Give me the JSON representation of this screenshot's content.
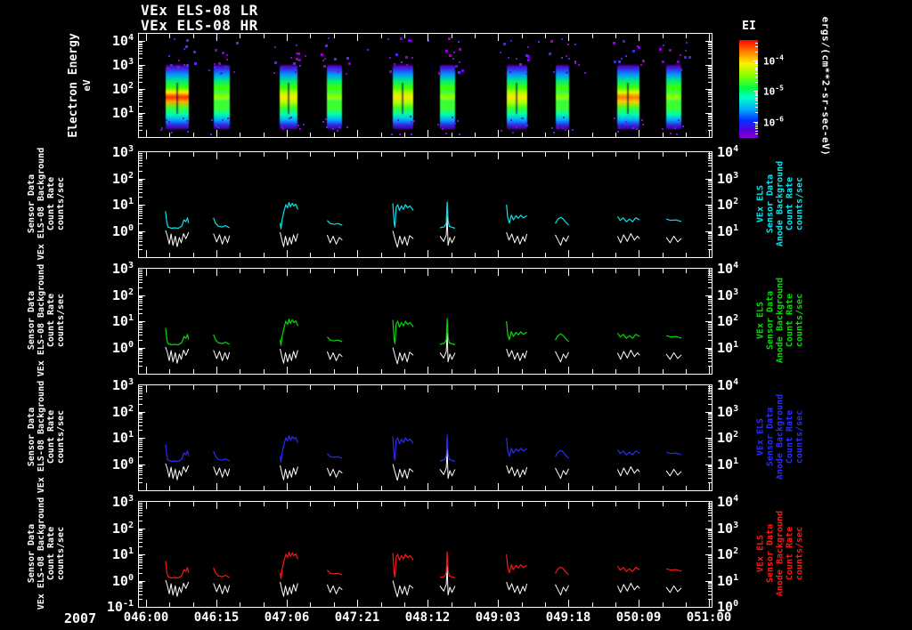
{
  "titles": {
    "line1": "VEx ELS-08 LR",
    "line2": "VEx ELS-08 HR"
  },
  "x_axis": {
    "year": "2007",
    "ticks": [
      {
        "label": "046:00",
        "fx": 0.0124
      },
      {
        "label": "046:15",
        "fx": 0.1354
      },
      {
        "label": "047:06",
        "fx": 0.2583
      },
      {
        "label": "047:21",
        "fx": 0.3813
      },
      {
        "label": "048:12",
        "fx": 0.5042
      },
      {
        "label": "049:03",
        "fx": 0.6272
      },
      {
        "label": "049:18",
        "fx": 0.7501
      },
      {
        "label": "050:09",
        "fx": 0.8731
      },
      {
        "label": "051:00",
        "fx": 0.996
      }
    ]
  },
  "chart_data": [
    {
      "type": "heatmap",
      "name": "electron-energy-spectrogram",
      "ylabel": "Electron Energy",
      "ylabel_units": "eV",
      "yscale": "log",
      "yrange": [
        1,
        20000
      ],
      "ytick_exps": [
        "4",
        "3",
        "2",
        "1"
      ],
      "colorbar": {
        "title": "EI",
        "units": "ergs/(cm**2-sr-sec-eV)",
        "tick_exps": [
          "-4",
          "-5",
          "-6"
        ],
        "tick_fys": [
          0.21,
          0.52,
          0.84
        ]
      },
      "energy_extent_exp": [
        0.55,
        2.95
      ],
      "bursts": [
        {
          "t0": "046:04",
          "t1": "046:09",
          "fx0": 0.0465,
          "fx1": 0.0868,
          "core": "red",
          "streak": true
        },
        {
          "t0": "046:14",
          "t1": "046:18",
          "fx0": 0.1302,
          "fx1": 0.1581,
          "core": "green",
          "streak": false
        },
        {
          "t0": "047:05",
          "t1": "047:08",
          "fx0": 0.2465,
          "fx1": 0.2775,
          "core": "yellow",
          "streak": true
        },
        {
          "t0": "047:15",
          "t1": "047:18",
          "fx0": 0.3287,
          "fx1": 0.355,
          "core": "green",
          "streak": false
        },
        {
          "t0": "048:05",
          "t1": "048:09",
          "fx0": 0.4434,
          "fx1": 0.4791,
          "core": "yellow",
          "streak": true
        },
        {
          "t0": "048:15",
          "t1": "048:18",
          "fx0": 0.5256,
          "fx1": 0.5519,
          "core": "green",
          "streak": false
        },
        {
          "t0": "049:05",
          "t1": "049:09",
          "fx0": 0.6419,
          "fx1": 0.6775,
          "core": "yellow",
          "streak": true
        },
        {
          "t0": "049:15",
          "t1": "049:18",
          "fx0": 0.7271,
          "fx1": 0.7504,
          "core": "green",
          "streak": false
        },
        {
          "t0": "050:04",
          "t1": "050:09",
          "fx0": 0.8357,
          "fx1": 0.8744,
          "core": "orange",
          "streak": true
        },
        {
          "t0": "050:15",
          "t1": "050:18",
          "fx0": 0.9209,
          "fx1": 0.9473,
          "core": "green",
          "streak": false
        }
      ]
    },
    {
      "type": "line",
      "name": "anode-background-count-rate-panels",
      "yscale": "log",
      "yrange": [
        0.1,
        1000
      ],
      "right_yrange": [
        1,
        10000
      ],
      "left_tick_exps": [
        "3",
        "2",
        "1",
        "0"
      ],
      "right_tick_exps": [
        "4",
        "3",
        "2",
        "1"
      ],
      "last_panel_bottom_left_exp": "-1",
      "last_panel_bottom_right_exp": "0",
      "left_label_lines": [
        "Sensor Data",
        "VEx ELS-08 Background",
        "Count Rate",
        "counts/sec"
      ],
      "right_label_lines": [
        "VEx ELS",
        "Sensor Data",
        "Anode Background",
        "Count Rate",
        "counts/sec"
      ],
      "panels": [
        {
          "name": "anode-panel-cyan",
          "color": "#00e6ef"
        },
        {
          "name": "anode-panel-green",
          "color": "#00dd00"
        },
        {
          "name": "anode-panel-blue",
          "color": "#2a2aff"
        },
        {
          "name": "anode-panel-red",
          "color": "#ff1515"
        }
      ],
      "bursts": [
        {
          "fx0": 0.0465,
          "fx1": 0.0868,
          "colored": [
            [
              0,
              0.75
            ],
            [
              0.05,
              0.35
            ],
            [
              0.1,
              0.15
            ],
            [
              0.25,
              0.1
            ],
            [
              0.4,
              0.12
            ],
            [
              0.55,
              0.1
            ],
            [
              0.7,
              0.18
            ],
            [
              0.8,
              0.42
            ],
            [
              0.88,
              0.35
            ],
            [
              0.95,
              0.5
            ],
            [
              1,
              0.3
            ]
          ],
          "white": [
            [
              0,
              0.02
            ],
            [
              0.08,
              -0.2
            ],
            [
              0.16,
              -0.5
            ],
            [
              0.24,
              -0.12
            ],
            [
              0.32,
              -0.55
            ],
            [
              0.42,
              -0.2
            ],
            [
              0.5,
              -0.6
            ],
            [
              0.6,
              -0.25
            ],
            [
              0.68,
              -0.45
            ],
            [
              0.78,
              -0.1
            ],
            [
              0.88,
              -0.3
            ],
            [
              1,
              -0.05
            ]
          ]
        },
        {
          "fx0": 0.1302,
          "fx1": 0.1581,
          "colored": [
            [
              0,
              0.5
            ],
            [
              0.12,
              0.3
            ],
            [
              0.3,
              0.18
            ],
            [
              0.55,
              0.15
            ],
            [
              0.75,
              0.2
            ],
            [
              1,
              0.12
            ]
          ],
          "white": [
            [
              0,
              -0.1
            ],
            [
              0.2,
              -0.42
            ],
            [
              0.38,
              -0.15
            ],
            [
              0.55,
              -0.5
            ],
            [
              0.72,
              -0.2
            ],
            [
              0.88,
              -0.45
            ],
            [
              1,
              -0.18
            ]
          ]
        },
        {
          "fx0": 0.2465,
          "fx1": 0.2775,
          "colored": [
            [
              0,
              0.3
            ],
            [
              0.05,
              0.08
            ],
            [
              0.12,
              0.45
            ],
            [
              0.22,
              0.75
            ],
            [
              0.32,
              1.0
            ],
            [
              0.42,
              0.88
            ],
            [
              0.5,
              1.08
            ],
            [
              0.58,
              0.92
            ],
            [
              0.68,
              1.05
            ],
            [
              0.78,
              0.95
            ],
            [
              0.88,
              1.02
            ],
            [
              1,
              0.82
            ]
          ],
          "white": [
            [
              0,
              -0.05
            ],
            [
              0.1,
              -0.35
            ],
            [
              0.2,
              -0.6
            ],
            [
              0.3,
              -0.2
            ],
            [
              0.42,
              -0.55
            ],
            [
              0.54,
              -0.25
            ],
            [
              0.64,
              -0.5
            ],
            [
              0.76,
              -0.15
            ],
            [
              0.88,
              -0.4
            ],
            [
              1,
              -0.1
            ]
          ]
        },
        {
          "fx0": 0.3287,
          "fx1": 0.355,
          "colored": [
            [
              0,
              0.4
            ],
            [
              0.2,
              0.28
            ],
            [
              0.45,
              0.25
            ],
            [
              0.7,
              0.28
            ],
            [
              1,
              0.22
            ]
          ],
          "white": [
            [
              0,
              -0.15
            ],
            [
              0.2,
              -0.45
            ],
            [
              0.4,
              -0.2
            ],
            [
              0.6,
              -0.5
            ],
            [
              0.8,
              -0.25
            ],
            [
              1,
              -0.35
            ]
          ]
        },
        {
          "fx0": 0.4434,
          "fx1": 0.4791,
          "colored": [
            [
              0,
              1.05
            ],
            [
              0.06,
              0.3
            ],
            [
              0.1,
              0.15
            ],
            [
              0.16,
              0.9
            ],
            [
              0.24,
              1.0
            ],
            [
              0.32,
              0.78
            ],
            [
              0.42,
              0.95
            ],
            [
              0.52,
              0.82
            ],
            [
              0.62,
              1.0
            ],
            [
              0.72,
              0.88
            ],
            [
              0.84,
              0.95
            ],
            [
              1,
              0.78
            ]
          ],
          "white": [
            [
              0,
              0.0
            ],
            [
              0.1,
              -0.3
            ],
            [
              0.22,
              -0.62
            ],
            [
              0.34,
              -0.2
            ],
            [
              0.46,
              -0.5
            ],
            [
              0.58,
              -0.22
            ],
            [
              0.7,
              -0.55
            ],
            [
              0.82,
              -0.18
            ],
            [
              1,
              -0.3
            ]
          ]
        },
        {
          "fx0": 0.5256,
          "fx1": 0.5519,
          "colored": [
            [
              0,
              0.12
            ],
            [
              0.3,
              0.16
            ],
            [
              0.42,
              0.3
            ],
            [
              0.48,
              1.1
            ],
            [
              0.54,
              0.4
            ],
            [
              0.62,
              0.18
            ],
            [
              0.8,
              0.14
            ],
            [
              1,
              0.1
            ]
          ],
          "white": [
            [
              0,
              -0.2
            ],
            [
              0.25,
              -0.4
            ],
            [
              0.42,
              -0.15
            ],
            [
              0.48,
              0.55
            ],
            [
              0.54,
              -0.55
            ],
            [
              0.66,
              -0.25
            ],
            [
              0.8,
              -0.45
            ],
            [
              1,
              -0.2
            ]
          ]
        },
        {
          "fx0": 0.6419,
          "fx1": 0.6775,
          "colored": [
            [
              0,
              1.0
            ],
            [
              0.06,
              0.5
            ],
            [
              0.14,
              0.3
            ],
            [
              0.24,
              0.6
            ],
            [
              0.34,
              0.42
            ],
            [
              0.46,
              0.58
            ],
            [
              0.58,
              0.48
            ],
            [
              0.7,
              0.6
            ],
            [
              0.82,
              0.5
            ],
            [
              1,
              0.58
            ]
          ],
          "white": [
            [
              0,
              -0.05
            ],
            [
              0.12,
              -0.35
            ],
            [
              0.26,
              -0.12
            ],
            [
              0.4,
              -0.45
            ],
            [
              0.54,
              -0.2
            ],
            [
              0.66,
              -0.5
            ],
            [
              0.8,
              -0.22
            ],
            [
              0.9,
              -0.4
            ],
            [
              1,
              -0.12
            ]
          ]
        },
        {
          "fx0": 0.7271,
          "fx1": 0.7504,
          "colored": [
            [
              0,
              0.28
            ],
            [
              0.2,
              0.45
            ],
            [
              0.4,
              0.52
            ],
            [
              0.6,
              0.45
            ],
            [
              0.8,
              0.32
            ],
            [
              1,
              0.22
            ]
          ],
          "white": [
            [
              0,
              -0.15
            ],
            [
              0.2,
              -0.35
            ],
            [
              0.4,
              -0.55
            ],
            [
              0.6,
              -0.25
            ],
            [
              0.8,
              -0.4
            ],
            [
              1,
              -0.18
            ]
          ]
        },
        {
          "fx0": 0.8357,
          "fx1": 0.8744,
          "colored": [
            [
              0,
              0.55
            ],
            [
              0.12,
              0.4
            ],
            [
              0.26,
              0.5
            ],
            [
              0.4,
              0.35
            ],
            [
              0.54,
              0.45
            ],
            [
              0.68,
              0.35
            ],
            [
              0.82,
              0.5
            ],
            [
              1,
              0.42
            ]
          ],
          "white": [
            [
              0,
              -0.2
            ],
            [
              0.14,
              -0.45
            ],
            [
              0.28,
              -0.15
            ],
            [
              0.44,
              -0.4
            ],
            [
              0.6,
              -0.1
            ],
            [
              0.76,
              -0.35
            ],
            [
              0.9,
              -0.2
            ],
            [
              1,
              -0.3
            ]
          ]
        },
        {
          "fx0": 0.9209,
          "fx1": 0.9473,
          "colored": [
            [
              0,
              0.45
            ],
            [
              0.3,
              0.4
            ],
            [
              0.6,
              0.42
            ],
            [
              1,
              0.36
            ]
          ],
          "white": [
            [
              0,
              -0.25
            ],
            [
              0.25,
              -0.45
            ],
            [
              0.5,
              -0.2
            ],
            [
              0.75,
              -0.42
            ],
            [
              1,
              -0.28
            ]
          ]
        }
      ]
    }
  ]
}
